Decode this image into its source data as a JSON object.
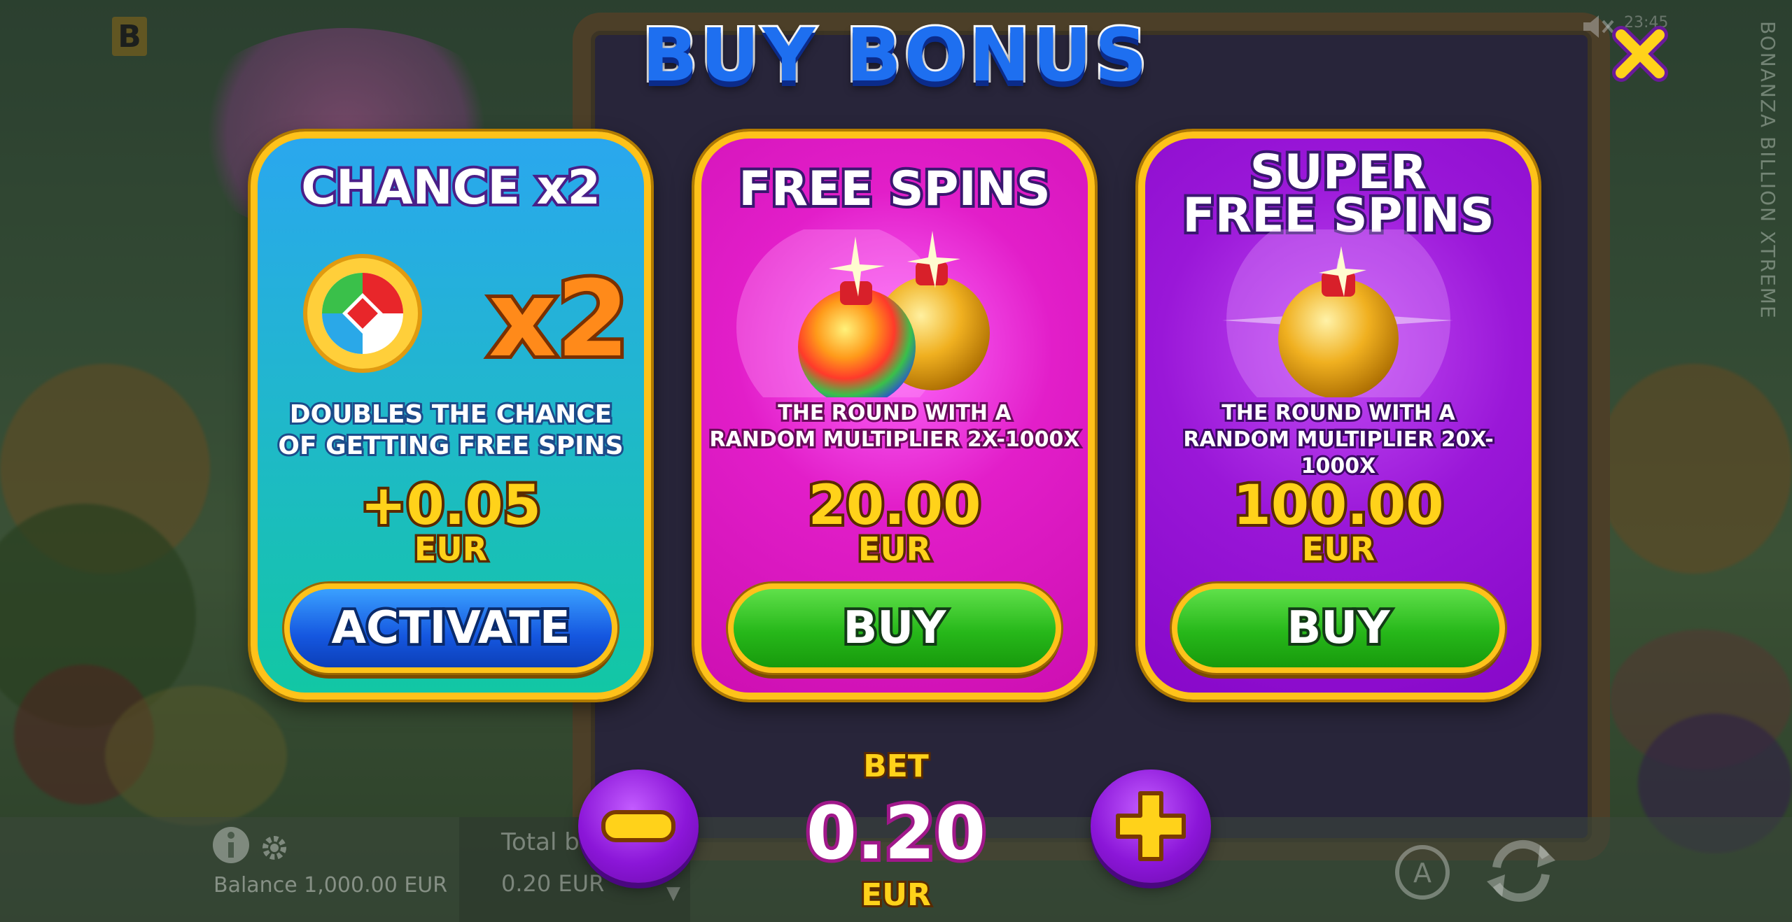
{
  "brand_badge": "B",
  "side_title": "BONANZA BILLION XTREME",
  "clock": "23:45",
  "title": "BUY BONUS",
  "cards": [
    {
      "title_lines": [
        "CHANCE x2"
      ],
      "desc_lines": [
        "DOUBLES THE CHANCE",
        "OF GETTING FREE SPINS"
      ],
      "price": "+0.05",
      "currency": "EUR",
      "button": "ACTIVATE",
      "accent": "#21b6cf"
    },
    {
      "title_lines": [
        "FREE SPINS"
      ],
      "desc_lines": [
        "THE ROUND WITH A",
        "RANDOM MULTIPLIER 2X-1000X"
      ],
      "price": "20.00",
      "currency": "EUR",
      "button": "BUY",
      "accent": "#e21ec9"
    },
    {
      "title_lines": [
        "SUPER",
        "FREE SPINS"
      ],
      "desc_lines": [
        "THE ROUND WITH A",
        "RANDOM MULTIPLIER 20X-1000X"
      ],
      "price": "100.00",
      "currency": "EUR",
      "button": "BUY",
      "accent": "#9a17d8"
    }
  ],
  "bet": {
    "label": "BET",
    "value": "0.20",
    "currency": "EUR"
  },
  "footer": {
    "balance": "Balance 1,000.00 EUR",
    "total_bet_label": "Total bet",
    "total_bet_value": "0.20 EUR",
    "auto_label": "A"
  }
}
